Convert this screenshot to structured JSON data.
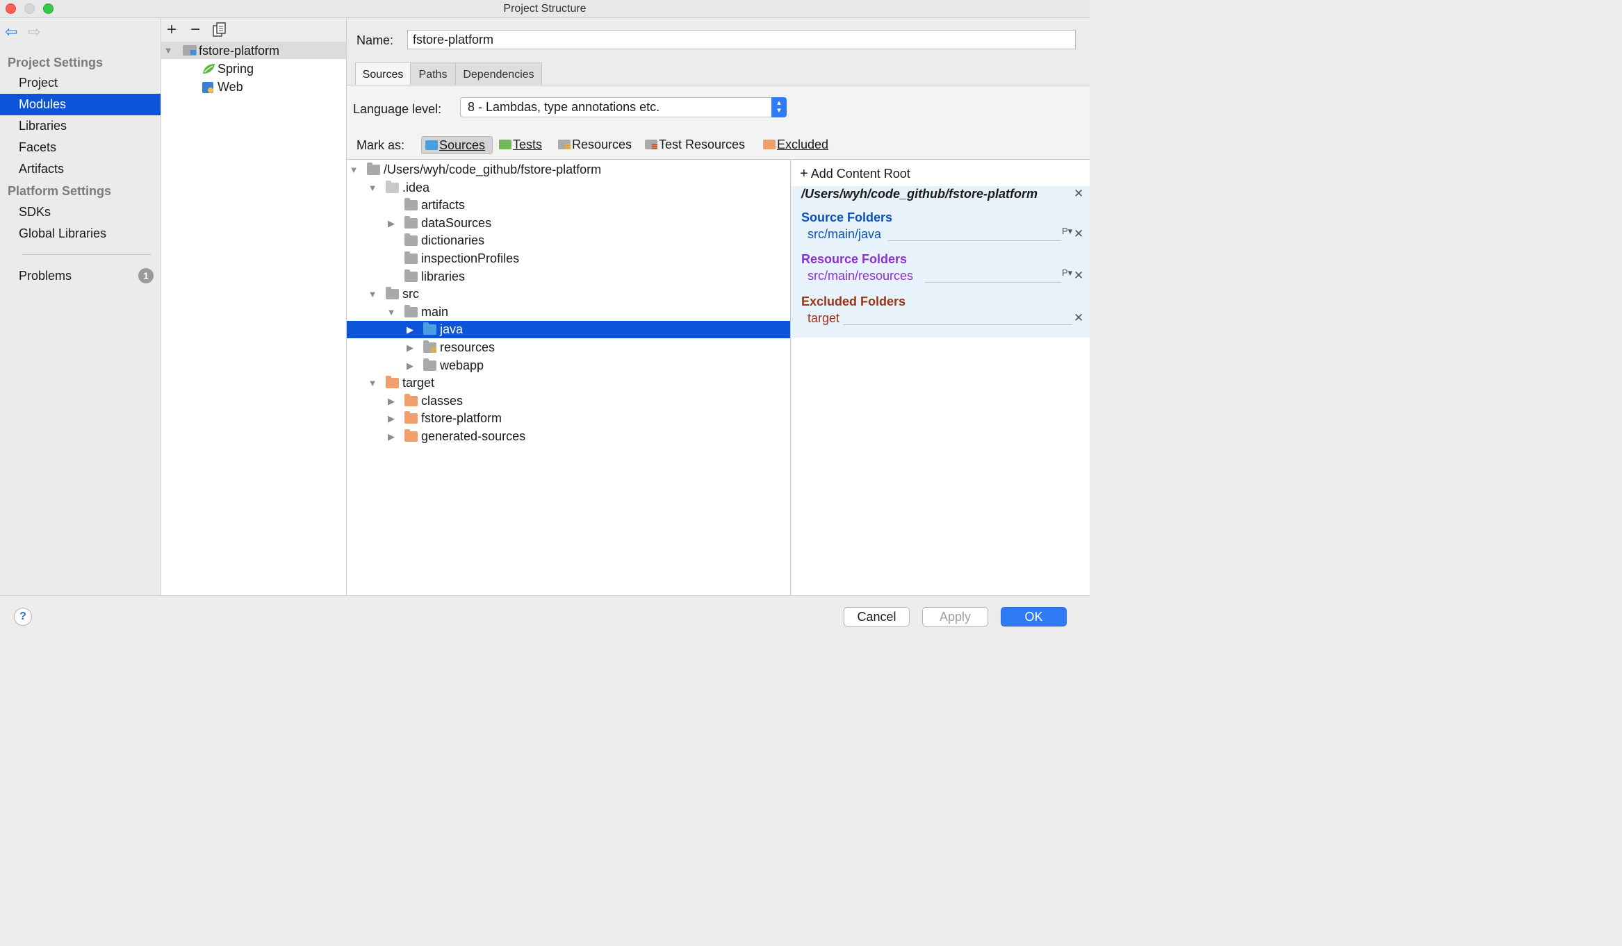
{
  "window": {
    "title": "Project Structure"
  },
  "left_nav": {
    "back_icon": "back-arrow-icon",
    "forward_icon": "forward-arrow-icon",
    "sections": [
      {
        "label": "Project Settings",
        "items": [
          "Project",
          "Modules",
          "Libraries",
          "Facets",
          "Artifacts"
        ]
      },
      {
        "label": "Platform Settings",
        "items": [
          "SDKs",
          "Global Libraries"
        ]
      }
    ],
    "selected": "Modules",
    "problems": {
      "label": "Problems",
      "count": "1"
    }
  },
  "modules": {
    "toolbar": [
      "+",
      "−",
      "copy-icon"
    ],
    "module_name": "fstore-platform",
    "facets": [
      "Spring",
      "Web"
    ]
  },
  "detail": {
    "name_label": "Name:",
    "name_value": "fstore-platform",
    "tabs": [
      "Sources",
      "Paths",
      "Dependencies"
    ],
    "active_tab": "Sources",
    "language_level_label": "Language level:",
    "language_level_value": "8 - Lambdas, type annotations etc.",
    "mark_as_label": "Mark as:",
    "mark_as": [
      "Sources",
      "Tests",
      "Resources",
      "Test Resources",
      "Excluded"
    ],
    "mark_as_active": "Sources"
  },
  "tree": {
    "rows": [
      {
        "label": "/Users/wyh/code_github/fstore-platform",
        "level": 0,
        "twisty": "open",
        "color": "#a9a9a9"
      },
      {
        "label": ".idea",
        "level": 1,
        "twisty": "open",
        "color": "#c9c9c9"
      },
      {
        "label": "artifacts",
        "level": 2,
        "twisty": "none",
        "color": "#a9a9a9"
      },
      {
        "label": "dataSources",
        "level": 2,
        "twisty": "closed",
        "color": "#a9a9a9"
      },
      {
        "label": "dictionaries",
        "level": 2,
        "twisty": "none",
        "color": "#a9a9a9"
      },
      {
        "label": "inspectionProfiles",
        "level": 2,
        "twisty": "none",
        "color": "#a9a9a9"
      },
      {
        "label": "libraries",
        "level": 2,
        "twisty": "none",
        "color": "#a9a9a9"
      },
      {
        "label": "src",
        "level": 1,
        "twisty": "open",
        "color": "#a9a9a9"
      },
      {
        "label": "main",
        "level": 2,
        "twisty": "open",
        "color": "#a9a9a9"
      },
      {
        "label": "java",
        "level": 3,
        "twisty": "closed",
        "color": "#4a9fe0",
        "selected": true
      },
      {
        "label": "resources",
        "level": 3,
        "twisty": "closed",
        "color": "#a9a9a9",
        "resource": true
      },
      {
        "label": "webapp",
        "level": 3,
        "twisty": "closed",
        "color": "#a9a9a9"
      },
      {
        "label": "target",
        "level": 1,
        "twisty": "open",
        "color": "#f09e6c"
      },
      {
        "label": "classes",
        "level": 2,
        "twisty": "closed",
        "color": "#f09e6c"
      },
      {
        "label": "fstore-platform",
        "level": 2,
        "twisty": "closed",
        "color": "#f09e6c"
      },
      {
        "label": "generated-sources",
        "level": 2,
        "twisty": "closed",
        "color": "#f09e6c"
      }
    ]
  },
  "content_roots": {
    "add_label": "Add Content Root",
    "root_path": "/Users/wyh/code_github/fstore-platform",
    "source_folders_label": "Source Folders",
    "source_folders": [
      "src/main/java"
    ],
    "resource_folders_label": "Resource Folders",
    "resource_folders": [
      "src/main/resources"
    ],
    "excluded_folders_label": "Excluded Folders",
    "excluded_folders": [
      "target"
    ],
    "colors": {
      "source": "#0b52b8",
      "resource": "#8b2fd6",
      "excluded": "#9a3412"
    }
  },
  "buttons": {
    "help": "?",
    "cancel": "Cancel",
    "apply": "Apply",
    "ok": "OK"
  }
}
